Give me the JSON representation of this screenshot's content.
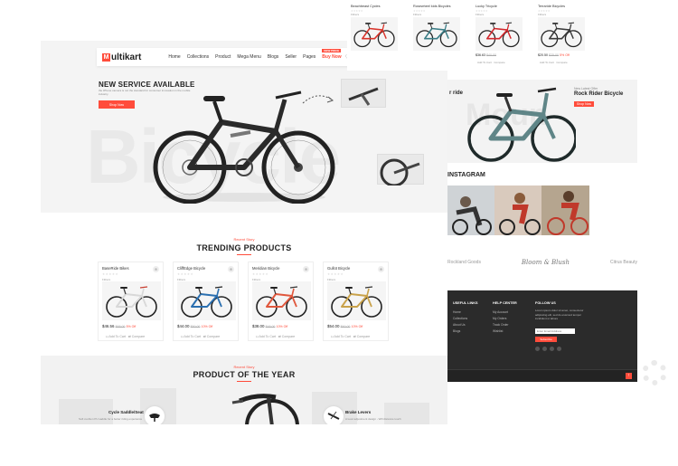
{
  "header": {
    "logo_text": "ultikart",
    "logo_letter": "M",
    "nav": [
      "Home",
      "Collections",
      "Product",
      "Mega Menu",
      "Blogs",
      "Seller",
      "Pages"
    ],
    "buy_now": "Buy Now",
    "new_tag": "NEW PRICE"
  },
  "hero": {
    "title": "NEW SERVICE AVAILABLE",
    "subtitle": "the iPhone camera is not the standard for consumer innovation in the mobile industry.",
    "button": "Shop Now",
    "watermark": "Bicycle"
  },
  "trending": {
    "eyebrow": "Recent Story",
    "title": "TRENDING PRODUCTS",
    "add_to_cart": "Add To Cart",
    "compare": "Compare",
    "products": [
      {
        "name": "BaseRide Bikes",
        "brand": "Fitbers",
        "price": "$46.56",
        "old": "$65.00",
        "off": "5% Off",
        "frame": "#d8d8d8",
        "accent": "#c73d2f"
      },
      {
        "name": "CliffEdge Bicycle",
        "brand": "Fitbers",
        "price": "$44.00",
        "old": "$50.00",
        "off": "10% Off",
        "frame": "#2a6fb0",
        "accent": "#222"
      },
      {
        "name": "Meridian Bicycle",
        "brand": "Fitbers",
        "price": "$38.00",
        "old": "$45.00",
        "off": "10% Off",
        "frame": "#e0573c",
        "accent": "#333"
      },
      {
        "name": "Gullot Bicycle",
        "brand": "Fitbers",
        "price": "$54.00",
        "old": "$60.00",
        "off": "10% Off",
        "frame": "#c9a24a",
        "accent": "#333"
      }
    ]
  },
  "product_of_year": {
    "eyebrow": "Recent Story",
    "title": "PRODUCT OF THE YEAR",
    "features": [
      {
        "title": "Cycle Saddle/Seat",
        "desc": "Soft cushion PU saddle for a better riding experience"
      },
      {
        "title": "Brake Levers",
        "desc": "A level adjustment design - Will distance touch"
      }
    ]
  },
  "top_strip": {
    "products": [
      {
        "name": "Beachbeast Cycles",
        "brand": "Fitbers",
        "price": "",
        "old": "",
        "off": "",
        "frame": "#d9342b"
      },
      {
        "name": "Rosewheel kids Bicycles",
        "brand": "Fitbers",
        "price": "",
        "old": "",
        "off": "",
        "frame": "#3a7d86"
      },
      {
        "name": "Lucky Tricycle",
        "brand": "Fitbers",
        "price": "$36.63",
        "old": "$40.00",
        "off": "",
        "frame": "#d2282d"
      },
      {
        "name": "Terraride Bicycles",
        "brand": "Fitbers",
        "price": "$20.50",
        "old": "$25.00",
        "off": "5% Off",
        "frame": "#3b3b3b"
      }
    ],
    "add_to_cart": "Add To Cart",
    "compare": "Compare"
  },
  "banner": {
    "left_text": "r ride",
    "eyebrow": "New Latest Offer",
    "title": "Rock Rider Bicycle",
    "button": "Shop Now",
    "watermark": "Moun"
  },
  "instagram": {
    "title": "INSTAGRAM"
  },
  "brands": [
    "Rockland Goods",
    "Bloom & Blush",
    "Citrus Beauty"
  ],
  "footer": {
    "col1_title": "USEFUL LINKS",
    "col1": [
      "Home",
      "Collections",
      "About Us",
      "Blogs"
    ],
    "col2_title": "HELP CENTER",
    "col2": [
      "My Account",
      "My Orders",
      "Track Order",
      "Wishlist"
    ],
    "col3_title": "FOLLOW US",
    "col3_text": "Lorem ipsum dolor sit amet, consectetur adipiscing elit, sed do eiusmod tempor incididunt ut labore",
    "email_placeholder": "Enter Email Address",
    "subscribe": "Subscribe"
  },
  "colors": {
    "accent": "#ff4c3b",
    "footer_bg": "#2b2b2b"
  }
}
